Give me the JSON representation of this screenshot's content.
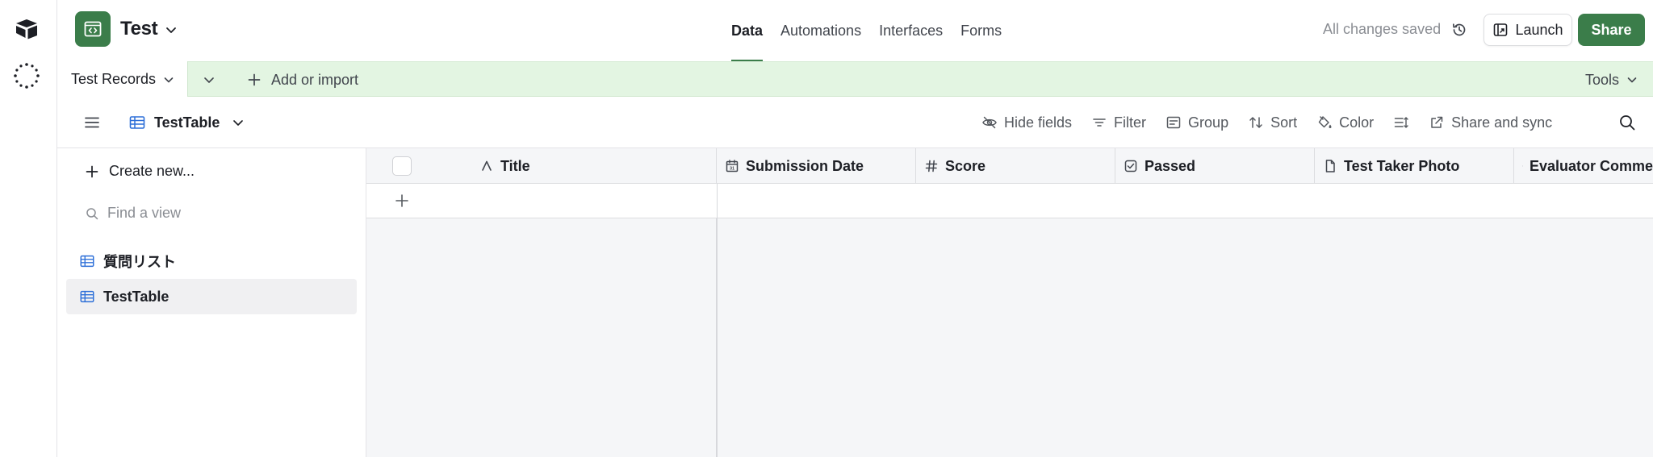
{
  "header": {
    "base_name": "Test",
    "tabs": [
      {
        "label": "Data",
        "active": true
      },
      {
        "label": "Automations",
        "active": false
      },
      {
        "label": "Interfaces",
        "active": false
      },
      {
        "label": "Forms",
        "active": false
      }
    ],
    "save_status": "All changes saved",
    "launch_label": "Launch",
    "share_label": "Share"
  },
  "tabbar": {
    "table_tab": "Test Records",
    "add_label": "Add or import",
    "tools_label": "Tools"
  },
  "viewbar": {
    "view_name": "TestTable",
    "tools": {
      "hide_fields": "Hide fields",
      "filter": "Filter",
      "group": "Group",
      "sort": "Sort",
      "color": "Color",
      "share_sync": "Share and sync"
    }
  },
  "sidebar": {
    "create_new": "Create new...",
    "find_placeholder": "Find a view",
    "views": [
      {
        "label": "質問リスト",
        "selected": false
      },
      {
        "label": "TestTable",
        "selected": true
      }
    ]
  },
  "grid": {
    "columns": [
      {
        "label": "Title",
        "icon": "text-a-icon"
      },
      {
        "label": "Submission Date",
        "icon": "calendar-icon"
      },
      {
        "label": "Score",
        "icon": "hash-icon"
      },
      {
        "label": "Passed",
        "icon": "checkbox-icon"
      },
      {
        "label": "Test Taker Photo",
        "icon": "file-icon"
      },
      {
        "label": "Evaluator Comme",
        "icon": "long-text-icon"
      }
    ]
  },
  "colors": {
    "brand_green": "#3b7d4a",
    "tabbar_bg": "#e3f5e2",
    "view_icon_blue": "#2d6fd8"
  }
}
